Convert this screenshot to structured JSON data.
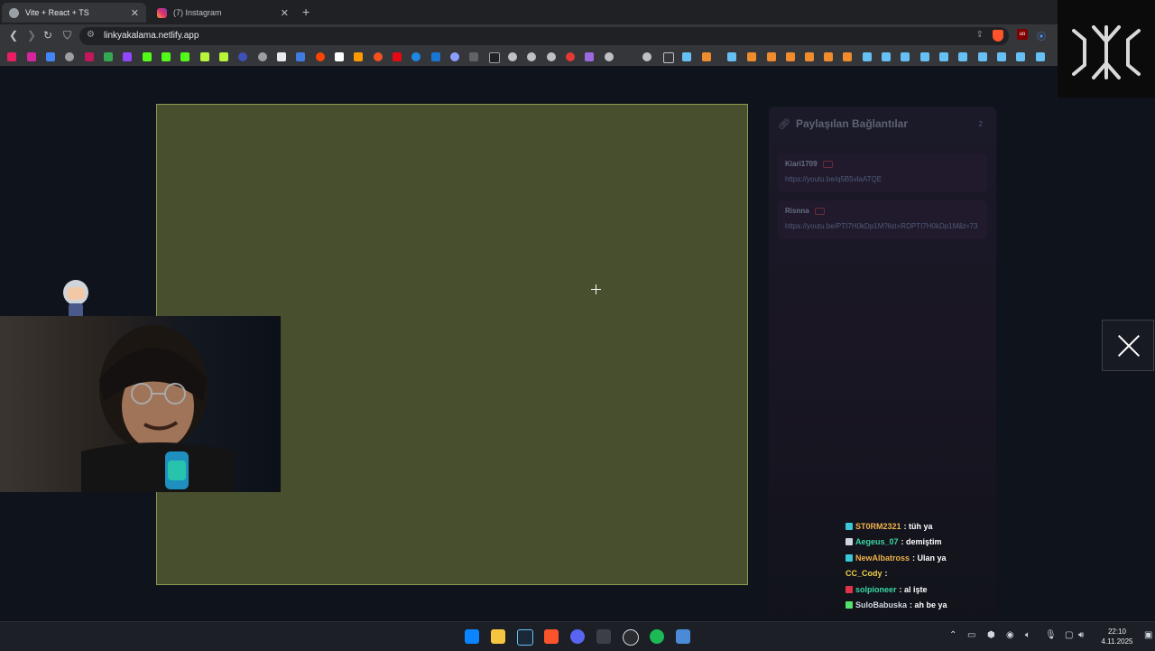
{
  "browser": {
    "tabs": [
      {
        "label": "Vite + React + TS",
        "active": true
      },
      {
        "label": "(7) Instagram",
        "active": false
      }
    ],
    "url": "linkyakalama.netlify.app",
    "shield_color": "#fb542b"
  },
  "links_panel": {
    "title": "Paylaşılan Bağlantılar",
    "count": "2",
    "items": [
      {
        "user": "Kiari1709",
        "url": "https://youtu.be/q5B5vlaATQE"
      },
      {
        "user": "Risnna",
        "url": "https://youtu.be/PTI7H0kDp1M?list=RDPTI7H0kDp1M&t=73"
      }
    ]
  },
  "canvas": {
    "background": "#484f2f",
    "border": "#8c9a4e"
  },
  "chat": [
    {
      "name": "ST0RM2321",
      "message": ": tüh ya",
      "color": "#f0b34a",
      "badge": "#3ac7d6"
    },
    {
      "name": "Aegeus_07",
      "message": ": demiştim",
      "color": "#3ad6a5",
      "badge": "#cfd6e0"
    },
    {
      "name": "NewAlbatross",
      "message": ": Ulan ya",
      "color": "#f0b34a",
      "badge": "#3ac7d6"
    },
    {
      "name": "CC_Cody",
      "message": ":",
      "color": "#f0d24a",
      "badge": ""
    },
    {
      "name": "solpioneer",
      "message": ": al işte",
      "color": "#3ad6a5",
      "badge": "#e0334a"
    },
    {
      "name": "SuloBabuska",
      "message": ": ah be ya",
      "color": "#cfd6e0",
      "badge": "#53e26b"
    }
  ],
  "taskbar": {
    "time": "22:10",
    "date": "4.11.2025"
  }
}
